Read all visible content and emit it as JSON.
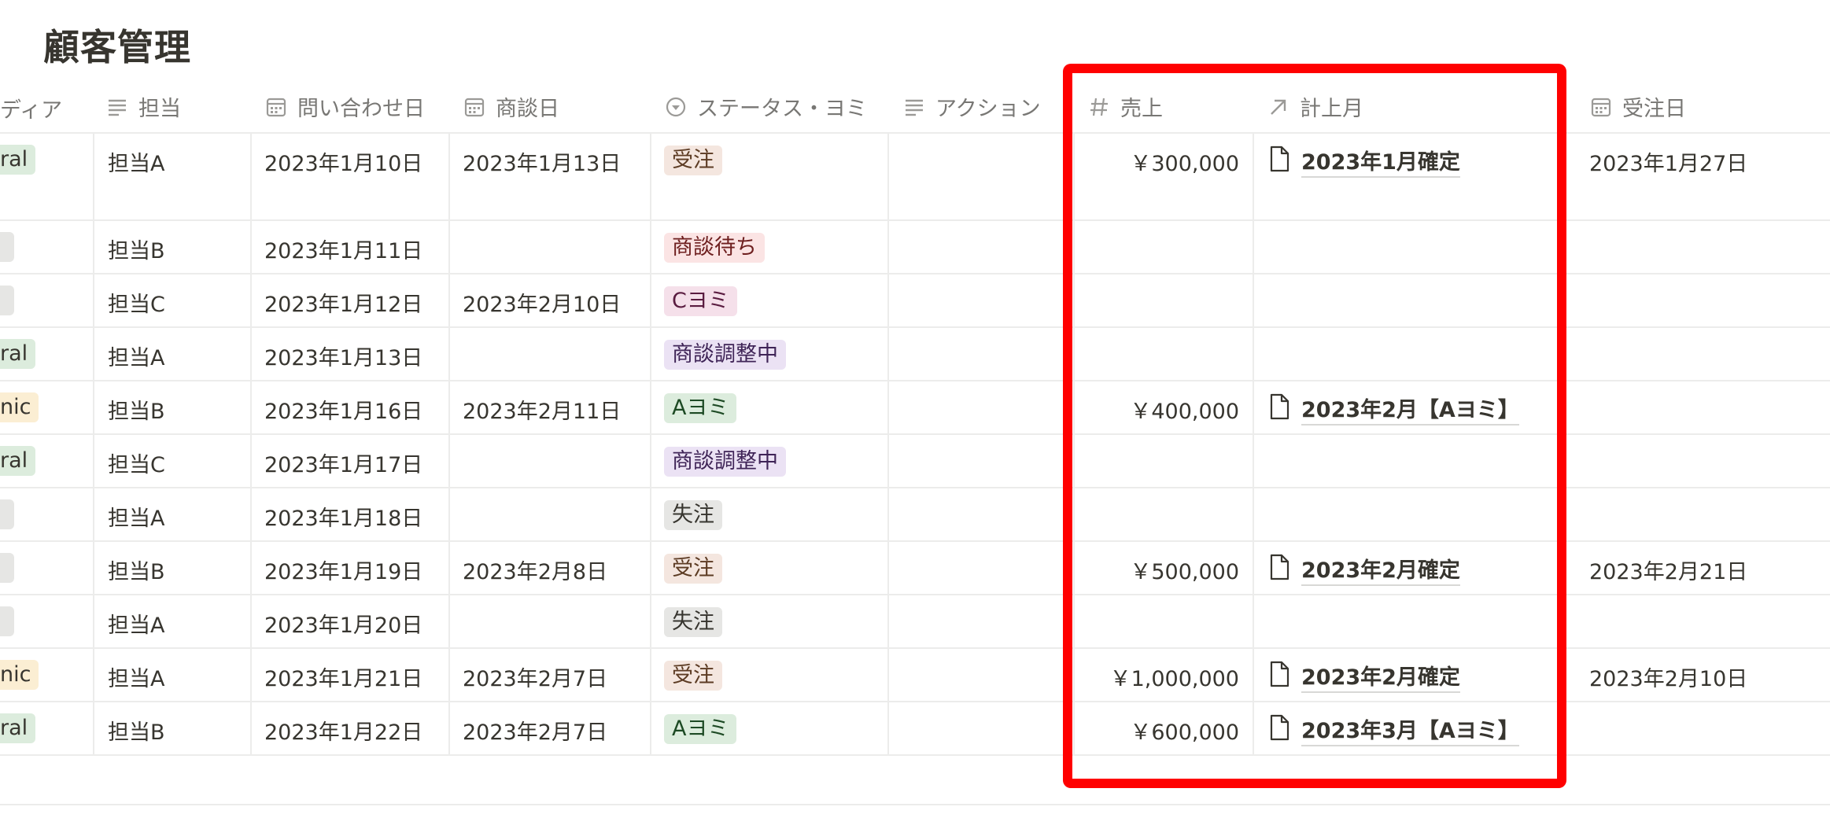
{
  "page": {
    "title": "顧客管理"
  },
  "headers": {
    "media": "ディア",
    "owner": "担当",
    "inquiry_date": "問い合わせ日",
    "meeting_date": "商談日",
    "status": "ステータス・ヨミ",
    "action": "アクション",
    "sales": "売上",
    "booking_month": "計上月",
    "order_date": "受注日"
  },
  "rows": [
    {
      "media": "ral",
      "owner": "担当A",
      "inquiry": "2023年1月10日",
      "meeting": "2023年1月13日",
      "status": "受注",
      "sales": "￥300,000",
      "month": "2023年1月確定",
      "order": "2023年1月27日"
    },
    {
      "media": "",
      "owner": "担当B",
      "inquiry": "2023年1月11日",
      "meeting": "",
      "status": "商談待ち",
      "sales": "",
      "month": "",
      "order": ""
    },
    {
      "media": "",
      "owner": "担当C",
      "inquiry": "2023年1月12日",
      "meeting": "2023年2月10日",
      "status": "Cヨミ",
      "sales": "",
      "month": "",
      "order": ""
    },
    {
      "media": "ral",
      "owner": "担当A",
      "inquiry": "2023年1月13日",
      "meeting": "",
      "status": "商談調整中",
      "sales": "",
      "month": "",
      "order": ""
    },
    {
      "media": "nic",
      "owner": "担当B",
      "inquiry": "2023年1月16日",
      "meeting": "2023年2月11日",
      "status": "Aヨミ",
      "sales": "￥400,000",
      "month": "2023年2月【Aヨミ】",
      "order": ""
    },
    {
      "media": "ral",
      "owner": "担当C",
      "inquiry": "2023年1月17日",
      "meeting": "",
      "status": "商談調整中",
      "sales": "",
      "month": "",
      "order": ""
    },
    {
      "media": "",
      "owner": "担当A",
      "inquiry": "2023年1月18日",
      "meeting": "",
      "status": "失注",
      "sales": "",
      "month": "",
      "order": ""
    },
    {
      "media": "",
      "owner": "担当B",
      "inquiry": "2023年1月19日",
      "meeting": "2023年2月8日",
      "status": "受注",
      "sales": "￥500,000",
      "month": "2023年2月確定",
      "order": "2023年2月21日"
    },
    {
      "media": "",
      "owner": "担当A",
      "inquiry": "2023年1月20日",
      "meeting": "",
      "status": "失注",
      "sales": "",
      "month": "",
      "order": ""
    },
    {
      "media": "nic",
      "owner": "担当A",
      "inquiry": "2023年1月21日",
      "meeting": "2023年2月7日",
      "status": "受注",
      "sales": "￥1,000,000",
      "month": "2023年2月確定",
      "order": "2023年2月10日"
    },
    {
      "media": "ral",
      "owner": "担当B",
      "inquiry": "2023年1月22日",
      "meeting": "2023年2月7日",
      "status": "Aヨミ",
      "sales": "￥600,000",
      "month": "2023年3月【Aヨミ】",
      "order": ""
    }
  ],
  "colors": {
    "tag_受注": "#f4e6df",
    "tag_受注_text": "#5c3b23",
    "tag_商談待ち": "#fbe4e4",
    "tag_商談待ち_text": "#6e1f1f",
    "tag_Cヨミ": "#f5e0ea",
    "tag_Cヨミ_text": "#5a1c40",
    "tag_商談調整中": "#ebe2f4",
    "tag_商談調整中_text": "#3f2457",
    "tag_Aヨミ": "#dcecdd",
    "tag_Aヨミ_text": "#1d4a24",
    "tag_失注": "#e6e6e4",
    "tag_失注_text": "#37352f",
    "media_ral": "#dcecdd",
    "media_nic": "#fbeed3",
    "highlight": "#ff0000"
  }
}
